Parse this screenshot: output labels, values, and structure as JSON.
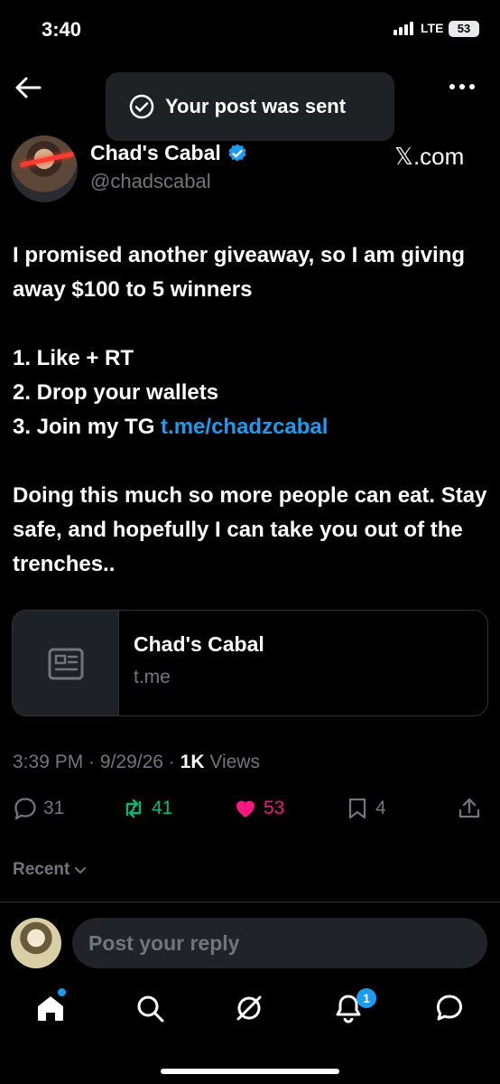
{
  "status_bar": {
    "time": "3:40",
    "network": "LTE",
    "battery": "53"
  },
  "toast": {
    "text": "Your post was sent"
  },
  "author": {
    "name": "Chad's Cabal",
    "handle": "@chadscabal",
    "source": "𝕏.com"
  },
  "post": {
    "line1": "I promised another giveaway, so I am giving away $100 to 5 winners",
    "item1": "1. Like + RT",
    "item2": "2. Drop your wallets",
    "item3_prefix": "3. Join my TG ",
    "item3_link": "t.me/chadzcabal",
    "closing": "Doing this much so more people can eat. Stay safe, and hopefully I can take you out of the trenches.."
  },
  "card": {
    "title": "Chad's Cabal",
    "domain": "t.me",
    "icon": "article-icon"
  },
  "meta": {
    "time": "3:39 PM",
    "sep1": " · ",
    "date": "9/29/26",
    "sep2": " · ",
    "views_count": "1K",
    "views_label": " Views"
  },
  "actions": {
    "replies": "31",
    "reposts": "41",
    "likes": "53",
    "bookmarks": "4"
  },
  "sort": {
    "label": "Recent"
  },
  "reply": {
    "placeholder": "Post your reply"
  },
  "tabbar": {
    "notification_count": "1"
  },
  "colors": {
    "accent": "#1d9bf0",
    "like": "#f91880",
    "repost": "#00ba7c",
    "muted": "#71767b"
  }
}
